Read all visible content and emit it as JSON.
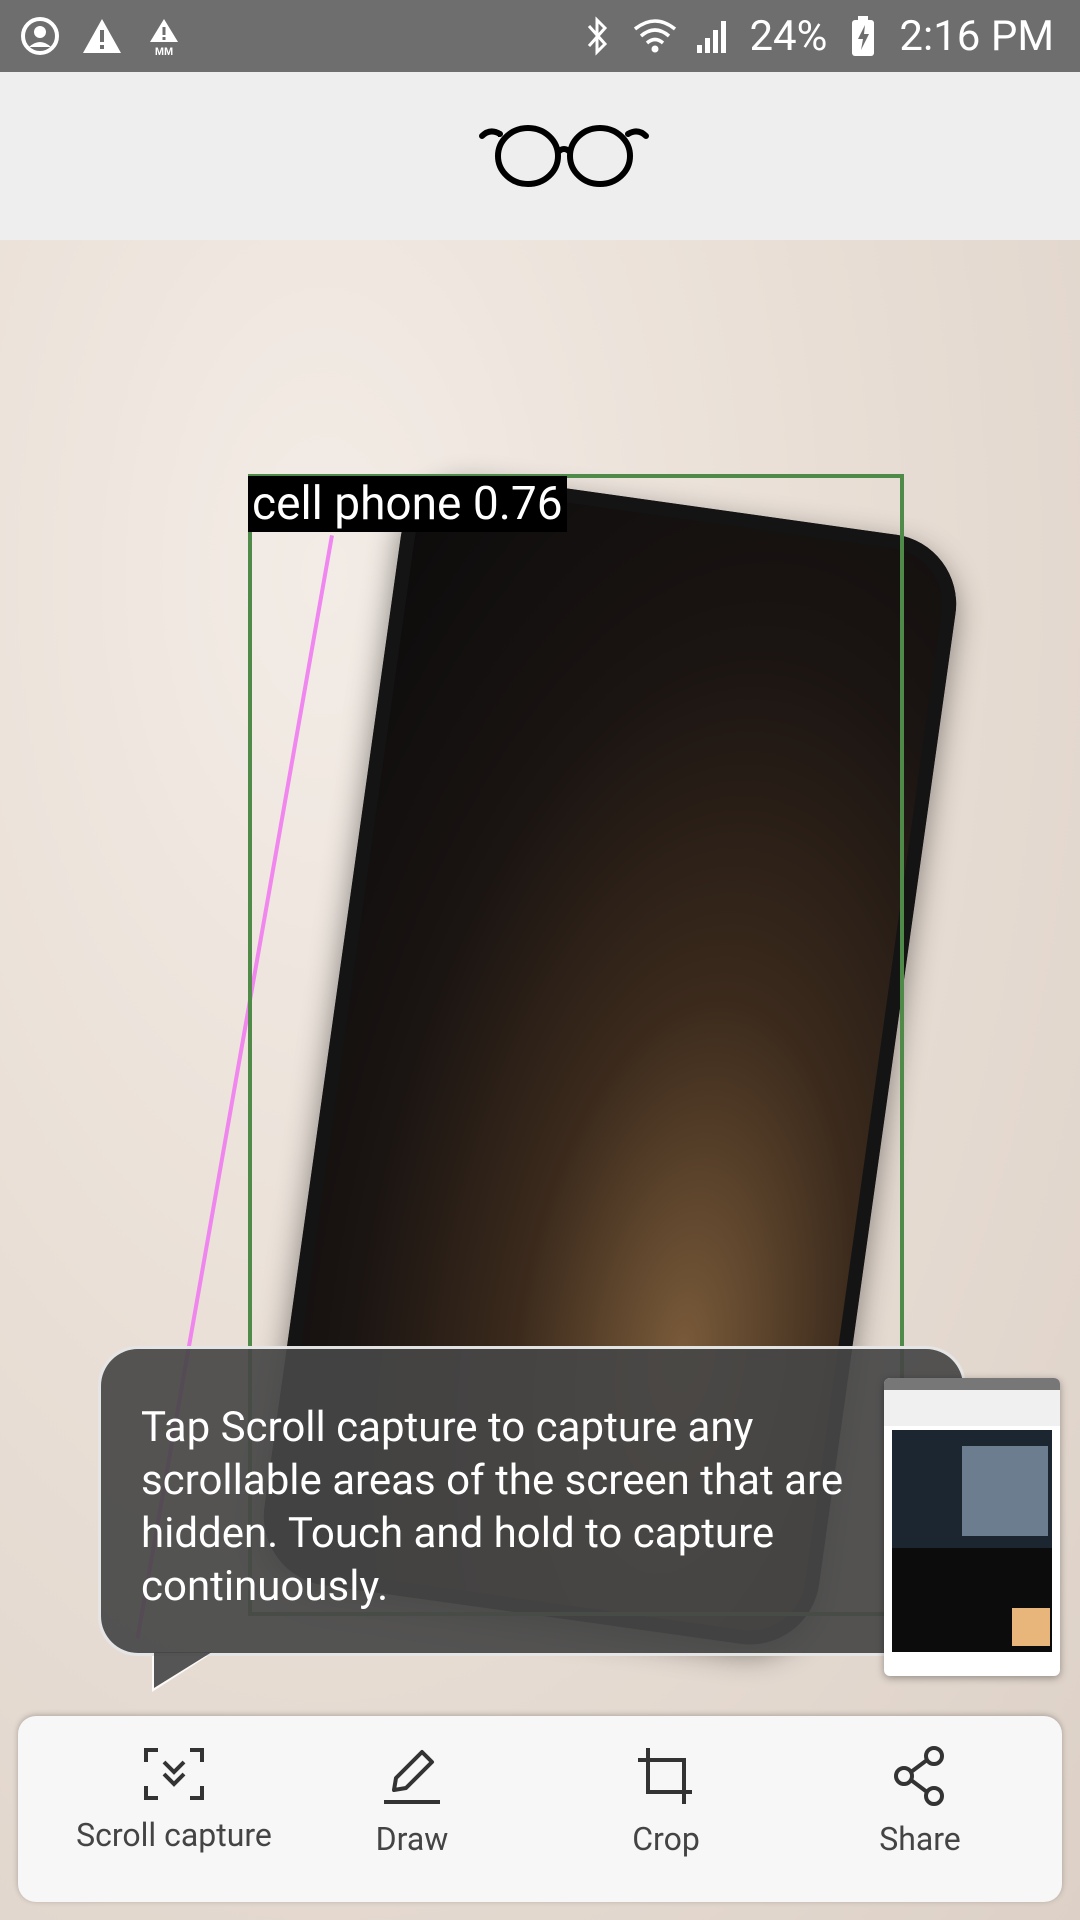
{
  "status_bar": {
    "battery": "24%",
    "time": "2:16 PM",
    "left_icons": [
      "account-circle-icon",
      "warning-icon",
      "mm-warning-icon"
    ],
    "right_icons": [
      "bluetooth-icon",
      "wifi-icon",
      "signal-icon",
      "battery-charging-icon"
    ]
  },
  "app_bar": {
    "logo_icon": "glasses-icon"
  },
  "detection": {
    "label": "cell phone 0.76",
    "box_color": "#4f8a49"
  },
  "tooltip": {
    "text": "Tap Scroll capture to capture any scrollable areas of the screen that are hidden. Touch and hold to capture continuously."
  },
  "toolbar": {
    "items": [
      {
        "label": "Scroll capture",
        "icon": "scroll-capture-icon"
      },
      {
        "label": "Draw",
        "icon": "pen-icon"
      },
      {
        "label": "Crop",
        "icon": "crop-icon"
      },
      {
        "label": "Share",
        "icon": "share-icon"
      }
    ]
  }
}
